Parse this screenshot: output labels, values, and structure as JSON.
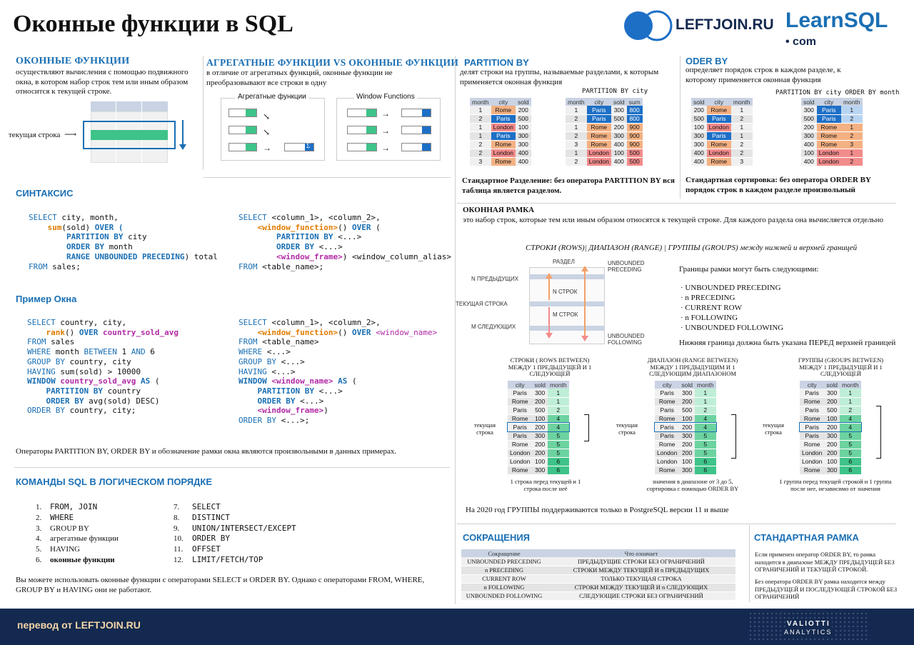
{
  "title": "Оконные функции в SQL",
  "logos": {
    "leftjoin": "LEFTJOIN.RU",
    "learnsql": "LearnSQL",
    "com": "• com"
  },
  "s1": {
    "heading": "ОКОННЫЕ ФУНКЦИИ",
    "text": "осуществляют вычисления с помощью подвижного окна, в котором набор строк тем или иным образом относится к текущей строке.",
    "current_row": "текущая строка"
  },
  "s2": {
    "heading": "АГРЕГАТНЫЕ ФУНКЦИИ VS ОКОННЫЕ ФУНКЦИИ",
    "text": "в отличие от агрегатных функций, оконные функции не преобразовывают все строки в одну",
    "agg": "Агрегатные функции",
    "win": "Window Functions",
    "sigma": "Σ"
  },
  "s3": {
    "heading": "PARTITION BY",
    "text": "делят строки на группы, называемые разделами, к которым применяется оконная функция",
    "caption": "PARTITION BY city",
    "note": "Стандартное Разделение: без оператора PARTITION BY вся таблица является разделом.",
    "t1_head": [
      "month",
      "city",
      "sold"
    ],
    "t1": [
      [
        "1",
        "Rome",
        "200"
      ],
      [
        "2",
        "Paris",
        "500"
      ],
      [
        "1",
        "London",
        "100"
      ],
      [
        "1",
        "Paris",
        "300"
      ],
      [
        "2",
        "Rome",
        "300"
      ],
      [
        "2",
        "London",
        "400"
      ],
      [
        "3",
        "Rome",
        "400"
      ]
    ],
    "t2_head": [
      "month",
      "city",
      "sold",
      "sum"
    ],
    "t2": [
      [
        "1",
        "Paris",
        "300",
        "800"
      ],
      [
        "2",
        "Paris",
        "500",
        "800"
      ],
      [
        "1",
        "Rome",
        "200",
        "900"
      ],
      [
        "2",
        "Rome",
        "300",
        "900"
      ],
      [
        "3",
        "Rome",
        "400",
        "900"
      ],
      [
        "1",
        "London",
        "100",
        "500"
      ],
      [
        "2",
        "London",
        "400",
        "500"
      ]
    ]
  },
  "s4": {
    "heading": "ODER BY",
    "text": "определяет порядок строк в каждом разделе, к которому применяется оконная функция",
    "caption": "PARTITION BY city ORDER BY month",
    "note": "Стандартная сортировка: без оператора ORDER BY порядок строк в каждом разделе произвольный",
    "t1_head": [
      "sold",
      "city",
      "month"
    ],
    "t1": [
      [
        "200",
        "Rome",
        "1"
      ],
      [
        "500",
        "Paris",
        "2"
      ],
      [
        "100",
        "London",
        "1"
      ],
      [
        "300",
        "Paris",
        "1"
      ],
      [
        "300",
        "Rome",
        "2"
      ],
      [
        "400",
        "London",
        "2"
      ],
      [
        "400",
        "Rome",
        "3"
      ]
    ],
    "t2_head": [
      "sold",
      "city",
      "month"
    ],
    "t2": [
      [
        "300",
        "Paris",
        "1"
      ],
      [
        "500",
        "Paris",
        "2"
      ],
      [
        "200",
        "Rome",
        "1"
      ],
      [
        "300",
        "Rome",
        "2"
      ],
      [
        "400",
        "Rome",
        "3"
      ],
      [
        "100",
        "London",
        "1"
      ],
      [
        "400",
        "London",
        "2"
      ]
    ]
  },
  "syntax": {
    "heading": "СИНТАКСИС"
  },
  "example": {
    "heading": "Пример Окна",
    "note": "Операторы PARTITION BY, ORDER BY и обозначение рамки окна являются произвольными в данных примерах."
  },
  "frame": {
    "heading": "ОКОННАЯ РАМКА",
    "text": "это набор строк, которые тем или иным образом относятся к текущей строке. Для каждого раздела она вычисляется отдельно",
    "subtitle": "СТРОКИ (ROWS)|  ДИАПАЗОН (RANGE) | ГРУППЫ (GROUPS) между нижней и верхней границей",
    "partition": "РАЗДЕЛ",
    "n_prev": "N ПРЕДЫДУЩИХ",
    "cur": "ТЕКУЩАЯ СТРОКА",
    "m_next": "М СЛЕДУЮЩИХ",
    "n_rows": "N СТРОК",
    "m_rows": "М СТРОК",
    "unb_prec": "UNBOUNDED PRECEDING",
    "unb_fol": "UNBOUNDED FOLLOWING",
    "bounds_title": "Границы рамки могут быть следующими:",
    "bounds": [
      "UNBOUNDED PRECEDING",
      "n PRECEDING",
      "CURRENT ROW",
      "n FOLLOWING",
      "UNBOUNDED FOLLOWING"
    ],
    "bounds_note": "Нижняя граница должна быть указана ПЕРЕД верхней границей",
    "rows_title": "СТРОКИ ( ROWS BETWEEN) МЕЖДУ 1 ПРЕДЫДУЩЕЙ И 1 СЛЕДУЮЩЕЙ",
    "range_title": "ДИАПАЗОН (RANGE BETWEEN) МЕЖДУ 1 ПРЕДЫДУЩИМ И 1 СЛЕДУЮЩИМ ДИАПАЗОНОМ",
    "groups_title": "ГРУППЫ (GROUPS BETWEEN) МЕЖДУ 1 ПРЕДЫДУЩЕЙ И 1 СЛЕДУЮЩЕЙ",
    "rows_note": "1 строка перед текущей и 1 строка после неё",
    "range_note": "значения в диапазоне от 3 до 5, сортировка с помощью ORDER BY",
    "groups_note": "1 группа перед текущей строкой и 1 группа после нее, независимо от значения",
    "cur_label": "текущая строка",
    "ft_head": [
      "city",
      "sold",
      "month"
    ],
    "ft": [
      [
        "Paris",
        "300",
        "1"
      ],
      [
        "Rome",
        "200",
        "1"
      ],
      [
        "Paris",
        "500",
        "2"
      ],
      [
        "Rome",
        "100",
        "4"
      ],
      [
        "Paris",
        "200",
        "4"
      ],
      [
        "Paris",
        "300",
        "5"
      ],
      [
        "Rome",
        "200",
        "5"
      ],
      [
        "London",
        "200",
        "5"
      ],
      [
        "London",
        "100",
        "6"
      ],
      [
        "Rome",
        "300",
        "6"
      ]
    ],
    "pg_note": "На 2020 год ГРУППЫ поддерживаются только в PostgreSQL версии 11 и выше"
  },
  "order": {
    "heading": "КОМАНДЫ SQL В ЛОГИЧЕСКОМ ПОРЯДКЕ",
    "left": [
      "FROM, JOIN",
      "WHERE",
      "GROUP BY",
      "агрегатные функции",
      "HAVING",
      "оконные функции"
    ],
    "right": [
      "SELECT",
      "DISTINCT",
      "UNION/INTERSECT/EXCEPT",
      "ORDER BY",
      "OFFSET",
      "LIMIT/FETCH/TOP"
    ],
    "note": "Вы можете использовать оконные функции с операторами SELECT и ORDER BY. Однако с операторами FROM, WHERE, GROUP BY и HAVING они не работают."
  },
  "abbr": {
    "heading": "СОКРАЩЕНИЯ",
    "col1": "Сокращение",
    "col2": "Что означает",
    "rows": [
      [
        "UNBOUNDED PRECEDING",
        "ПРЕДЫДУЩИЕ СТРОКИ БЕЗ ОГРАНИЧЕНИЙ"
      ],
      [
        "n  PRECEDING",
        "СТРОКИ МЕЖДУ ТЕКУЩЕЙ И n ПРЕДЫДУЩИХ"
      ],
      [
        "CURRENT ROW",
        "ТОЛЬКО ТЕКУЩАЯ СТРОКА"
      ],
      [
        "n  FOLLOWING",
        "СТРОКИ МЕЖДУ ТЕКУЩЕЙ И n СЛЕДУЮЩИХ"
      ],
      [
        "UNBOUNDED FOLLOWING",
        "СЛЕДУЮЩИЕ СТРОКИ БЕЗ ОГРАНИЧЕНИЙ"
      ]
    ]
  },
  "stdframe": {
    "heading": "СТАНДАРТНАЯ РАМКА",
    "p1": "Если применен оператор ORDER BY, то рамка находится в диапазоне МЕЖДУ ПРЕДЫДУЩЕЙ БЕЗ ОГРАНИЧЕНИЙ И ТЕКУЩЕЙ СТРОКОЙ.",
    "p2": "Без оператора ORDER BY рамка находится между ПРЕДЫДУЩЕЙ И ПОСЛЕДУЮЩЕЙ СТРОКОЙ БЕЗ ОГРАНИЧЕНИЙ"
  },
  "footer": {
    "left": "перевод от LEFTJOIN.RU",
    "right1": "VALIOTTI",
    "right2": "ANALYTICS"
  }
}
